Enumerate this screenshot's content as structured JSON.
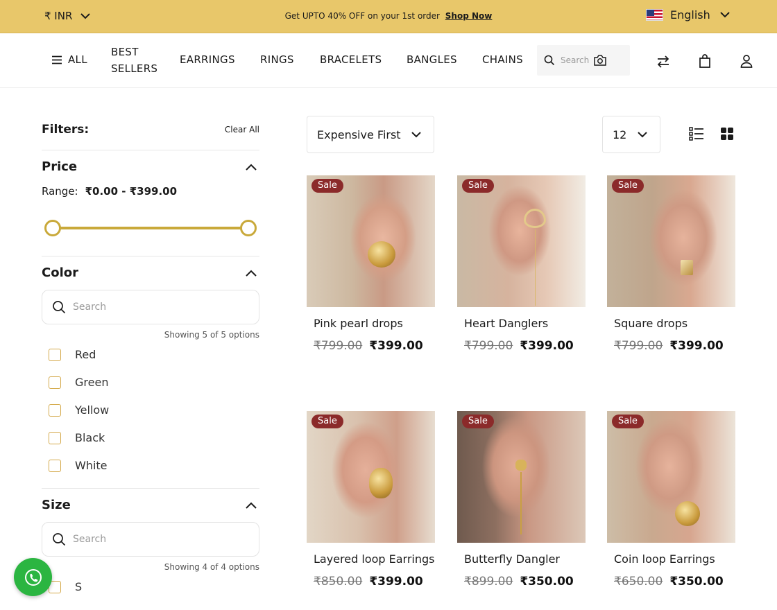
{
  "announcement": {
    "currency": "₹ INR",
    "promo_text": "Get UPTO 40% OFF on your 1st order",
    "promo_link": "Shop Now",
    "language": "English"
  },
  "nav": {
    "all_label": "ALL",
    "items": [
      "BEST SELLERS",
      "EARRINGS",
      "RINGS",
      "BRACELETS",
      "BANGLES",
      "CHAINS"
    ],
    "search_placeholder": "Search"
  },
  "filters": {
    "title": "Filters:",
    "clear_all": "Clear All",
    "price": {
      "title": "Price",
      "range_label": "Range:",
      "range_value": "₹0.00 - ₹399.00",
      "min_fraction": 0,
      "max_fraction": 1
    },
    "color": {
      "title": "Color",
      "search_placeholder": "Search",
      "showing": "Showing 5 of 5 options",
      "options": [
        "Red",
        "Green",
        "Yellow",
        "Black",
        "White"
      ]
    },
    "size": {
      "title": "Size",
      "search_placeholder": "Search",
      "showing": "Showing 4 of 4 options",
      "options": [
        "S"
      ]
    }
  },
  "toolbar": {
    "sort_value": "Expensive First",
    "per_page_value": "12"
  },
  "products": [
    {
      "badge": "Sale",
      "name": "Pink pearl drops",
      "old_price": "₹799.00",
      "price": "₹399.00"
    },
    {
      "badge": "Sale",
      "name": "Heart Danglers",
      "old_price": "₹799.00",
      "price": "₹399.00"
    },
    {
      "badge": "Sale",
      "name": "Square drops",
      "old_price": "₹799.00",
      "price": "₹399.00"
    },
    {
      "badge": "Sale",
      "name": "Layered loop Earrings",
      "old_price": "₹850.00",
      "price": "₹399.00"
    },
    {
      "badge": "Sale",
      "name": "Butterfly Dangler",
      "old_price": "₹899.00",
      "price": "₹350.00"
    },
    {
      "badge": "Sale",
      "name": "Coin loop Earrings",
      "old_price": "₹650.00",
      "price": "₹350.00"
    }
  ],
  "colors": {
    "announce_bg": "#e8c76a",
    "accent_gold": "#c9a93a",
    "sale_badge": "#8b2a2a",
    "whatsapp": "#2bb541"
  }
}
